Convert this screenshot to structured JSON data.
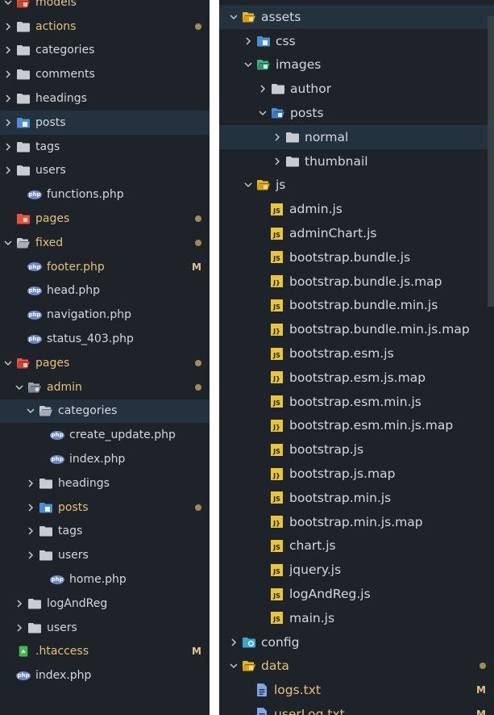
{
  "left": {
    "rows": [
      {
        "label": "models",
        "indent": 0,
        "chev": "down",
        "icon": "folder-red-open",
        "style": "mod",
        "dot": false
      },
      {
        "label": "actions",
        "indent": 0,
        "chev": "right",
        "icon": "folder",
        "style": "yellow",
        "dot": true
      },
      {
        "label": "categories",
        "indent": 0,
        "chev": "right",
        "icon": "folder",
        "style": "",
        "dot": false
      },
      {
        "label": "comments",
        "indent": 0,
        "chev": "right",
        "icon": "folder",
        "style": "",
        "dot": false
      },
      {
        "label": "headings",
        "indent": 0,
        "chev": "right",
        "icon": "folder",
        "style": "",
        "dot": false
      },
      {
        "label": "posts",
        "indent": 0,
        "chev": "right",
        "icon": "folder-blue",
        "style": "",
        "dot": false,
        "selected": true
      },
      {
        "label": "tags",
        "indent": 0,
        "chev": "right",
        "icon": "folder",
        "style": "",
        "dot": false
      },
      {
        "label": "users",
        "indent": 0,
        "chev": "right",
        "icon": "folder",
        "style": "",
        "dot": false
      },
      {
        "label": "functions.php",
        "indent": 1,
        "chev": "none",
        "icon": "php",
        "style": "",
        "dot": false
      },
      {
        "label": "pages",
        "indent": 0,
        "chev": "none",
        "icon": "folder-red",
        "style": "yellow",
        "dot": true
      },
      {
        "label": "fixed",
        "indent": 0,
        "chev": "down",
        "icon": "folder-open",
        "style": "yellow",
        "dot": true
      },
      {
        "label": "footer.php",
        "indent": 1,
        "chev": "none",
        "icon": "php",
        "style": "yellow",
        "badge": "M"
      },
      {
        "label": "head.php",
        "indent": 1,
        "chev": "none",
        "icon": "php",
        "style": "",
        "dot": false
      },
      {
        "label": "navigation.php",
        "indent": 1,
        "chev": "none",
        "icon": "php",
        "style": "",
        "dot": false
      },
      {
        "label": "status_403.php",
        "indent": 1,
        "chev": "none",
        "icon": "php",
        "style": "",
        "dot": false
      },
      {
        "label": "pages",
        "indent": 0,
        "chev": "down",
        "icon": "folder-red-open",
        "style": "yellow",
        "dot": true
      },
      {
        "label": "admin",
        "indent": 1,
        "chev": "down",
        "icon": "folder-admin",
        "style": "yellow",
        "dot": true
      },
      {
        "label": "categories",
        "indent": 2,
        "chev": "down",
        "icon": "folder-open",
        "style": "",
        "dot": false,
        "selected": true
      },
      {
        "label": "create_update.php",
        "indent": 3,
        "chev": "none",
        "icon": "php",
        "style": "",
        "dot": false
      },
      {
        "label": "index.php",
        "indent": 3,
        "chev": "none",
        "icon": "php",
        "style": "",
        "dot": false
      },
      {
        "label": "headings",
        "indent": 2,
        "chev": "right",
        "icon": "folder",
        "style": "",
        "dot": false
      },
      {
        "label": "posts",
        "indent": 2,
        "chev": "right",
        "icon": "folder-blue",
        "style": "yellow",
        "dot": true
      },
      {
        "label": "tags",
        "indent": 2,
        "chev": "right",
        "icon": "folder",
        "style": "",
        "dot": false
      },
      {
        "label": "users",
        "indent": 2,
        "chev": "right",
        "icon": "folder",
        "style": "",
        "dot": false
      },
      {
        "label": "home.php",
        "indent": 3,
        "chev": "none",
        "icon": "php",
        "style": "",
        "dot": false
      },
      {
        "label": "logAndReg",
        "indent": 1,
        "chev": "right",
        "icon": "folder",
        "style": "",
        "dot": false
      },
      {
        "label": "users",
        "indent": 1,
        "chev": "right",
        "icon": "folder",
        "style": "",
        "dot": false
      },
      {
        "label": ".htaccess",
        "indent": 0,
        "chev": "none",
        "icon": "htaccess",
        "style": "yellow",
        "badge": "M"
      },
      {
        "label": "index.php",
        "indent": 0,
        "chev": "none",
        "icon": "php",
        "style": "",
        "dot": false
      }
    ]
  },
  "right": {
    "rows": [
      {
        "label": "assets",
        "indent": 0,
        "chev": "down",
        "icon": "folder-yellow-open",
        "style": "",
        "dot": false,
        "selected": true
      },
      {
        "label": "css",
        "indent": 1,
        "chev": "right",
        "icon": "folder-blue",
        "style": "",
        "dot": false
      },
      {
        "label": "images",
        "indent": 1,
        "chev": "down",
        "icon": "folder-green-open",
        "style": "",
        "dot": false
      },
      {
        "label": "author",
        "indent": 2,
        "chev": "right",
        "icon": "folder",
        "style": "",
        "dot": false
      },
      {
        "label": "posts",
        "indent": 2,
        "chev": "down",
        "icon": "folder-blue-open",
        "style": "",
        "dot": false
      },
      {
        "label": "normal",
        "indent": 3,
        "chev": "right",
        "icon": "folder",
        "style": "",
        "dot": false,
        "selected": true
      },
      {
        "label": "thumbnail",
        "indent": 3,
        "chev": "right",
        "icon": "folder",
        "style": "",
        "dot": false
      },
      {
        "label": "js",
        "indent": 1,
        "chev": "down",
        "icon": "folder-yellow-open",
        "style": "",
        "dot": false
      },
      {
        "label": "admin.js",
        "indent": 2,
        "chev": "none",
        "icon": "js",
        "style": "",
        "dot": false
      },
      {
        "label": "adminChart.js",
        "indent": 2,
        "chev": "none",
        "icon": "js",
        "style": "",
        "dot": false
      },
      {
        "label": "bootstrap.bundle.js",
        "indent": 2,
        "chev": "none",
        "icon": "js",
        "style": "",
        "dot": false
      },
      {
        "label": "bootstrap.bundle.js.map",
        "indent": 2,
        "chev": "none",
        "icon": "jsmap",
        "style": "",
        "dot": false
      },
      {
        "label": "bootstrap.bundle.min.js",
        "indent": 2,
        "chev": "none",
        "icon": "js",
        "style": "",
        "dot": false
      },
      {
        "label": "bootstrap.bundle.min.js.map",
        "indent": 2,
        "chev": "none",
        "icon": "jsmap",
        "style": "",
        "dot": false
      },
      {
        "label": "bootstrap.esm.js",
        "indent": 2,
        "chev": "none",
        "icon": "js",
        "style": "",
        "dot": false
      },
      {
        "label": "bootstrap.esm.js.map",
        "indent": 2,
        "chev": "none",
        "icon": "jsmap",
        "style": "",
        "dot": false
      },
      {
        "label": "bootstrap.esm.min.js",
        "indent": 2,
        "chev": "none",
        "icon": "js",
        "style": "",
        "dot": false
      },
      {
        "label": "bootstrap.esm.min.js.map",
        "indent": 2,
        "chev": "none",
        "icon": "jsmap",
        "style": "",
        "dot": false
      },
      {
        "label": "bootstrap.js",
        "indent": 2,
        "chev": "none",
        "icon": "js",
        "style": "",
        "dot": false
      },
      {
        "label": "bootstrap.js.map",
        "indent": 2,
        "chev": "none",
        "icon": "jsmap",
        "style": "",
        "dot": false
      },
      {
        "label": "bootstrap.min.js",
        "indent": 2,
        "chev": "none",
        "icon": "js",
        "style": "",
        "dot": false
      },
      {
        "label": "bootstrap.min.js.map",
        "indent": 2,
        "chev": "none",
        "icon": "jsmap",
        "style": "",
        "dot": false
      },
      {
        "label": "chart.js",
        "indent": 2,
        "chev": "none",
        "icon": "js",
        "style": "",
        "dot": false
      },
      {
        "label": "jquery.js",
        "indent": 2,
        "chev": "none",
        "icon": "js",
        "style": "",
        "dot": false
      },
      {
        "label": "logAndReg.js",
        "indent": 2,
        "chev": "none",
        "icon": "js",
        "style": "",
        "dot": false
      },
      {
        "label": "main.js",
        "indent": 2,
        "chev": "none",
        "icon": "js",
        "style": "",
        "dot": false
      },
      {
        "label": "config",
        "indent": 0,
        "chev": "right",
        "icon": "folder-config",
        "style": "",
        "dot": false
      },
      {
        "label": "data",
        "indent": 0,
        "chev": "down",
        "icon": "folder-yellow-open",
        "style": "yellow",
        "dot": true
      },
      {
        "label": "logs.txt",
        "indent": 1,
        "chev": "none",
        "icon": "txt",
        "style": "yellow",
        "badge": "M"
      },
      {
        "label": "userLog.txt",
        "indent": 1,
        "chev": "none",
        "icon": "txt",
        "style": "yellow",
        "badge": "M"
      }
    ]
  },
  "colors": {
    "panel_bg": "#1e2329",
    "selection": "#24313f",
    "modified": "#e2c08d",
    "php_icon": "#6b83c9",
    "js_icon": "#e8c53a"
  }
}
